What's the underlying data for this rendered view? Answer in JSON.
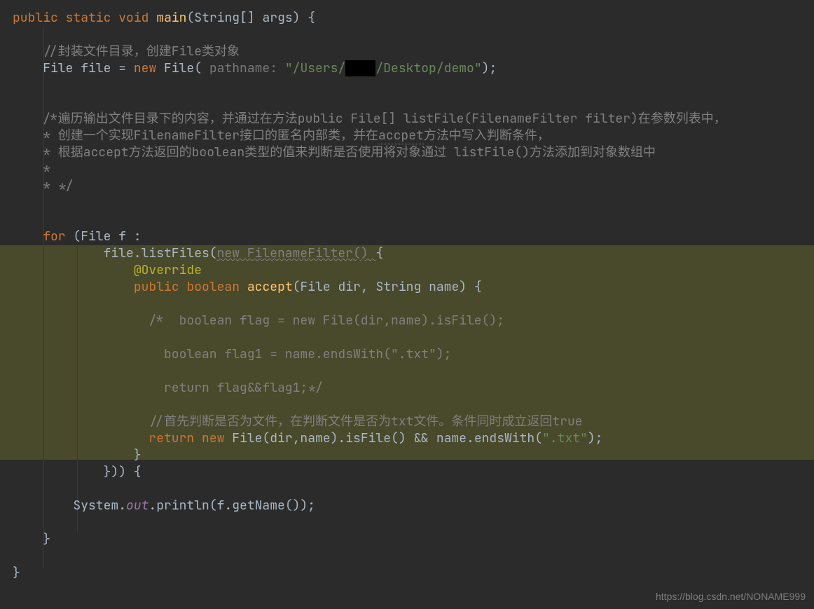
{
  "code": {
    "l1_kw1": "public",
    "l1_kw2": "static",
    "l1_kw3": "void",
    "l1_main": "main",
    "l1_rest": "(String[] args) {",
    "l3_comment": "//封装文件目录，创建File类对象",
    "l4_a": "File file = ",
    "l4_new": "new",
    "l4_b": " File(",
    "l4_hint": " pathname: ",
    "l4_str": "\"/Users/",
    "l4_mask": "    ",
    "l4_str2": "/Desktop/demo\"",
    "l4_c": ");",
    "l7": "/*遍历输出文件目录下的内容，并通过在方法public File[] listFile(FilenameFilter filter)在参数列表中，",
    "l8_a": "* 创建一个实现FilenameFilter接口的匿名内部类，并在",
    "l8_u": "accpet",
    "l8_b": "方法中写入判断条件，",
    "l9": "* 根据accept方法返回的boolean类型的值来判断是否使用将对象通过 listFile()方法添加到对象数组中",
    "l10": "*",
    "l11": "* */",
    "l14_for": "for",
    "l14_rest": " (File f :",
    "l15_a": "file.listFiles(",
    "l15_wavy": "new FilenameFilter() ",
    "l15_b": "{",
    "l16": "@Override",
    "l17_kw1": "public",
    "l17_kw2": "boolean",
    "l17_accept": "accept",
    "l17_rest": "(File dir, String name) {",
    "l19": "/*  boolean flag = new File(dir,name).isFile();",
    "l21": "boolean flag1 = name.endsWith(\".txt\");",
    "l23": "return flag&&flag1;*/",
    "l25": "//首先判断是否为文件，在判断文件是否为txt文件。条件同时成立返回true",
    "l26_ret": "return",
    "l26_new": "new",
    "l26_a": " File(dir,name).isFile() && name.endsWith(",
    "l26_str": "\".txt\"",
    "l26_b": ");",
    "l27": "}",
    "l28": "})) {",
    "l30_a": "System.",
    "l30_out": "out",
    "l30_b": ".println(f.getName());",
    "l32": "}",
    "l34": "}"
  },
  "watermark": "https://blog.csdn.net/NONAME999"
}
